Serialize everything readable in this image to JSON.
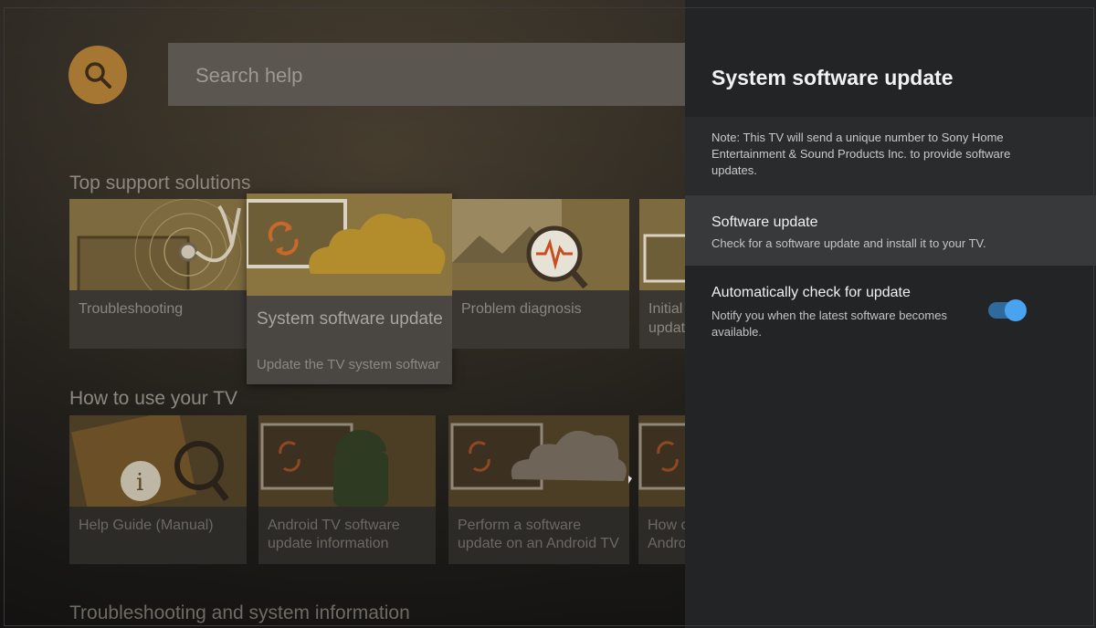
{
  "search": {
    "placeholder": "Search help"
  },
  "sections": {
    "top": "Top support solutions",
    "howto": "How to use your TV",
    "troubleshooting": "Troubleshooting and system information"
  },
  "top_tiles": {
    "troubleshooting": "Troubleshooting",
    "focused_title": "System software update",
    "focused_subtitle": "Update the TV system softwar",
    "problem_diagnosis": "Problem diagnosis",
    "initial_setup": "Initial setup",
    "initial_setup_line2": "updat"
  },
  "howto_tiles": {
    "help_guide": "Help Guide (Manual)",
    "android_update_l1": "Android TV software",
    "android_update_l2": "update information",
    "perform_update_l1": "Perform a software",
    "perform_update_l2": "update on an Android TV",
    "howto_l1": "How c",
    "howto_l2": "Andro"
  },
  "panel": {
    "title": "System software update",
    "note": "Note: This TV will send a unique number to Sony Home Entertainment & Sound Products Inc. to provide software updates.",
    "items": [
      {
        "label": "Software update",
        "description": "Check for a software update and install it to your TV."
      },
      {
        "label": "Automatically check for update",
        "description": "Notify you when the latest software becomes available.",
        "toggle_on": true
      }
    ]
  },
  "colors": {
    "panel_bg": "#232426",
    "accent_blue": "#4aa3ef",
    "search_button": "#a57733"
  },
  "icons": [
    "search-icon",
    "sync-icon",
    "stethoscope-icon",
    "magnifier-pulse-icon",
    "info-icon",
    "android-icon",
    "cloud-icon"
  ]
}
